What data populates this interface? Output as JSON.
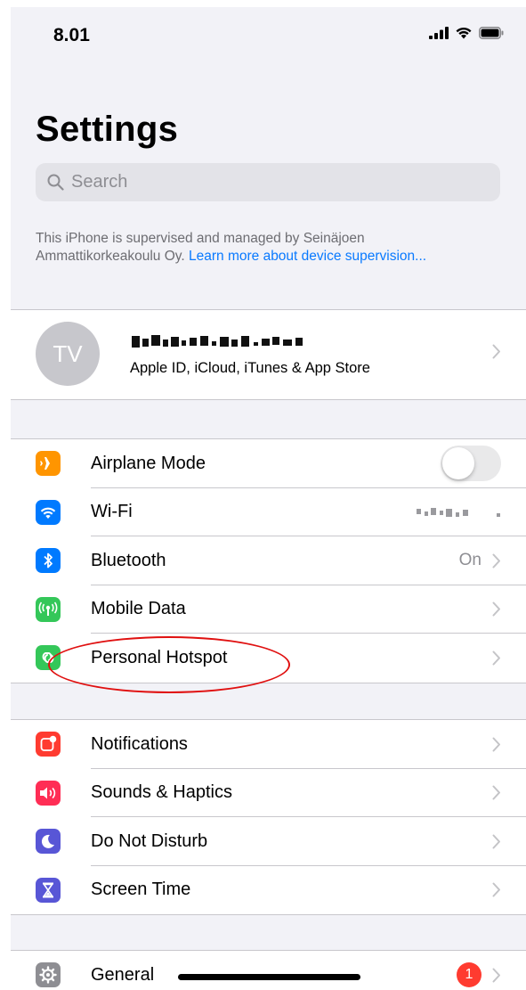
{
  "status_bar": {
    "time": "8.01"
  },
  "header": {
    "title": "Settings"
  },
  "search": {
    "placeholder": "Search"
  },
  "supervision": {
    "text": "This iPhone is supervised and managed by Seinäjoen Ammattikorkeakoulu Oy. ",
    "link": "Learn more about device supervision..."
  },
  "profile": {
    "initials": "TV",
    "subtitle": "Apple ID, iCloud, iTunes & App Store"
  },
  "connectivity": [
    {
      "label": "Airplane Mode",
      "icon": "airplane-icon",
      "color": "#ff9500",
      "toggle_on": false
    },
    {
      "label": "Wi-Fi",
      "icon": "wifi-icon",
      "color": "#007aff"
    },
    {
      "label": "Bluetooth",
      "icon": "bluetooth-icon",
      "color": "#007aff",
      "value": "On"
    },
    {
      "label": "Mobile Data",
      "icon": "antenna-icon",
      "color": "#34c759"
    },
    {
      "label": "Personal Hotspot",
      "icon": "hotspot-icon",
      "color": "#34c759"
    }
  ],
  "alerts": [
    {
      "label": "Notifications",
      "icon": "notifications-icon",
      "color": "#ff3b30"
    },
    {
      "label": "Sounds & Haptics",
      "icon": "speaker-icon",
      "color": "#ff2d55"
    },
    {
      "label": "Do Not Disturb",
      "icon": "moon-icon",
      "color": "#5856d6"
    },
    {
      "label": "Screen Time",
      "icon": "hourglass-icon",
      "color": "#5856d6"
    }
  ],
  "general": [
    {
      "label": "General",
      "icon": "gear-icon",
      "color": "#8e8e93",
      "badge": "1"
    }
  ]
}
